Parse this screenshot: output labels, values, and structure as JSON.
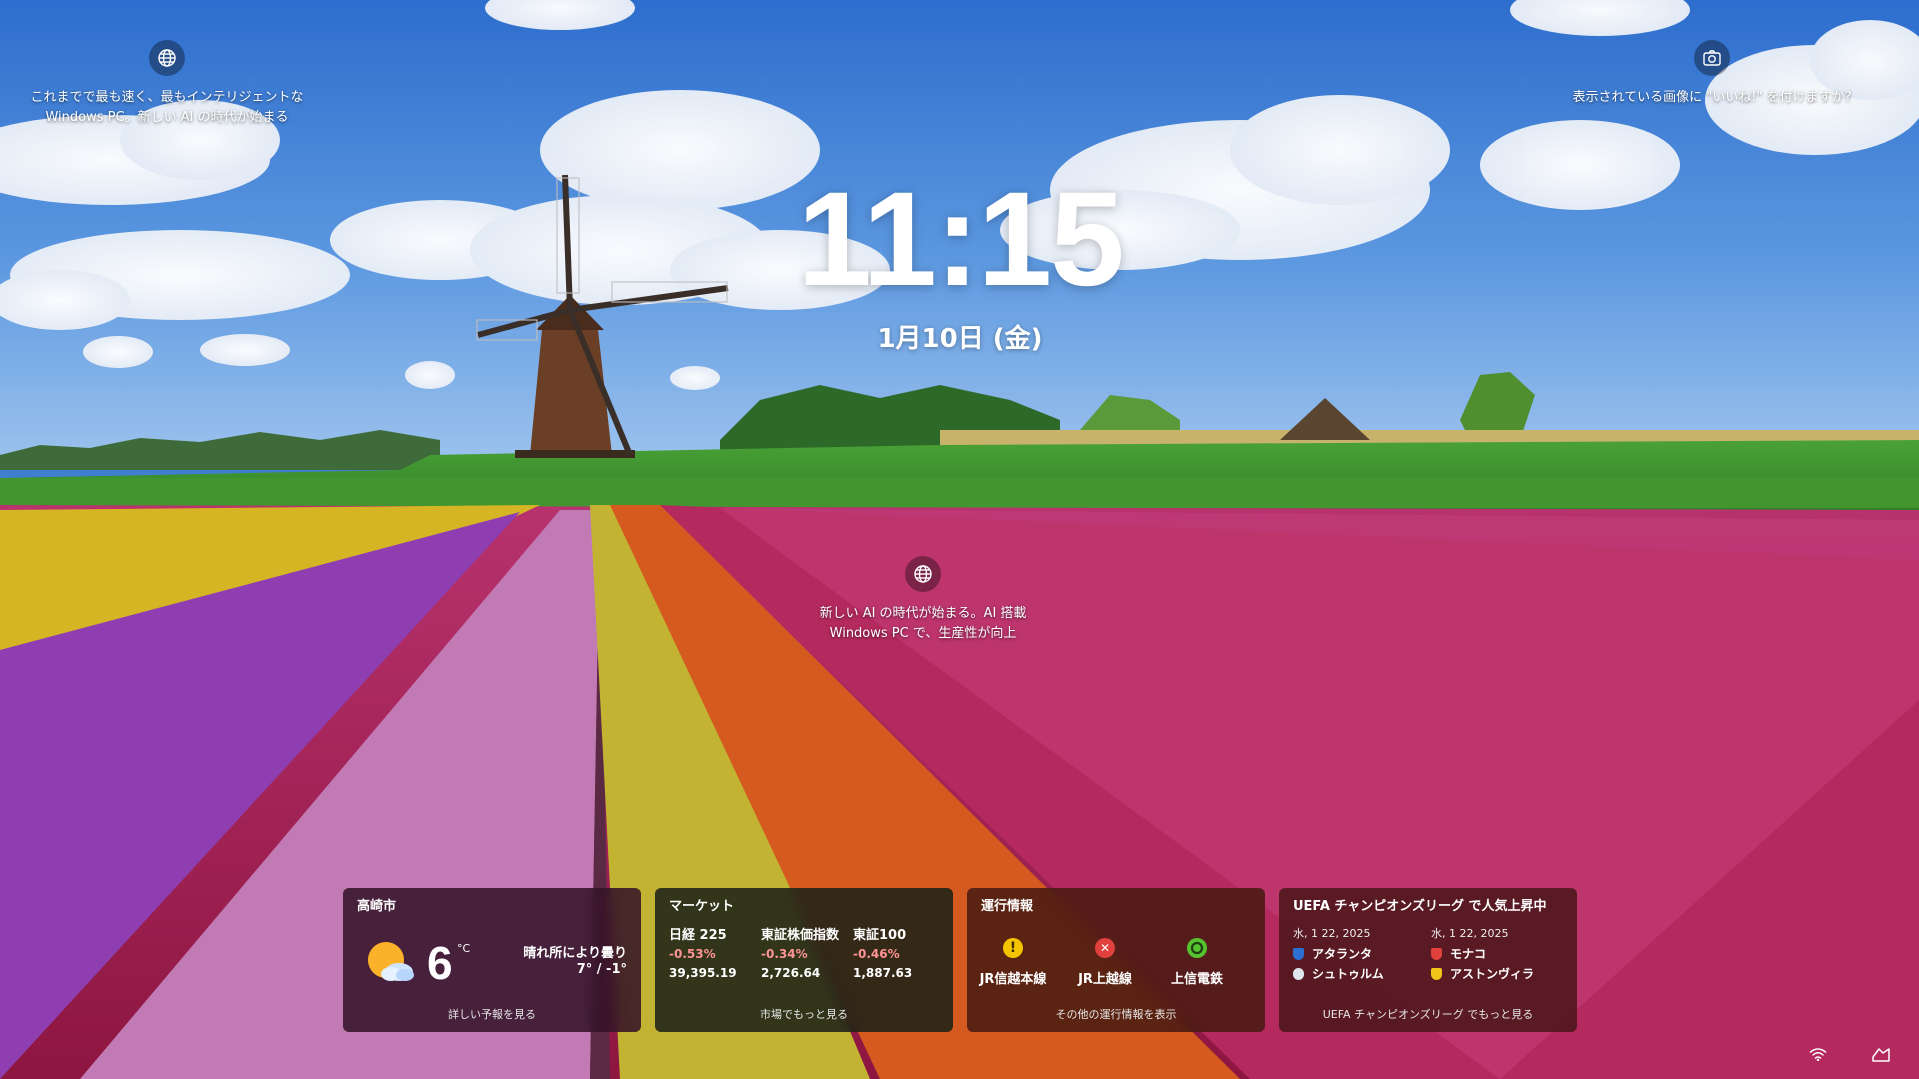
{
  "lock_screen": {
    "time": "11:15",
    "date": "1月10日 (金)"
  },
  "spotlight": {
    "top_left": {
      "icon": "globe-icon",
      "lines": [
        "これまでで最も速く、最もインテリジェントな",
        "Windows PC。新しい AI の時代が始まる"
      ]
    },
    "top_right": {
      "icon": "camera-icon",
      "text": "表示されている画像に \"いいね!\" を付けますか?"
    },
    "middle": {
      "icon": "globe-icon",
      "lines": [
        "新しい AI の時代が始まる。AI 搭載",
        "Windows PC で、生産性が向上"
      ]
    }
  },
  "widgets": {
    "weather": {
      "title": "高崎市",
      "temperature": "6",
      "unit": "°C",
      "condition": "晴れ所により曇り",
      "high_low": "7° / -1°",
      "icon": "sun-cloud-icon",
      "footer": "詳しい予報を見る"
    },
    "market": {
      "title": "マーケット",
      "items": [
        {
          "name": "日経 225",
          "change": "-0.53%",
          "value": "39,395.19"
        },
        {
          "name": "東証株価指数",
          "change": "-0.34%",
          "value": "2,726.64"
        },
        {
          "name": "東証100",
          "change": "-0.46%",
          "value": "1,887.63"
        }
      ],
      "change_color": "#ff9494",
      "footer": "市場でもっと見る"
    },
    "traffic": {
      "title": "運行情報",
      "lines": [
        {
          "name": "JR信越本線",
          "status": "warning",
          "icon": "warning-icon",
          "color": "#f5c400"
        },
        {
          "name": "JR上越線",
          "status": "suspended",
          "icon": "error-icon",
          "color": "#e0413d"
        },
        {
          "name": "上信電鉄",
          "status": "normal",
          "icon": "ok-icon",
          "color": "#56c230"
        }
      ],
      "footer": "その他の運行情報を表示"
    },
    "football": {
      "title": "UEFA チャンピオンズリーグ で人気上昇中",
      "matches": [
        {
          "date": "水, 1 22, 2025",
          "teams": [
            "アタランタ",
            "シュトゥルム"
          ]
        },
        {
          "date": "水, 1 22, 2025",
          "teams": [
            "モナコ",
            "アストンヴィラ"
          ]
        }
      ],
      "footer": "UEFA チャンピオンズリーグ でもっと見る"
    }
  },
  "system_tray": {
    "network_icon": "wifi-icon",
    "accessibility_icon": "accessibility-icon"
  }
}
